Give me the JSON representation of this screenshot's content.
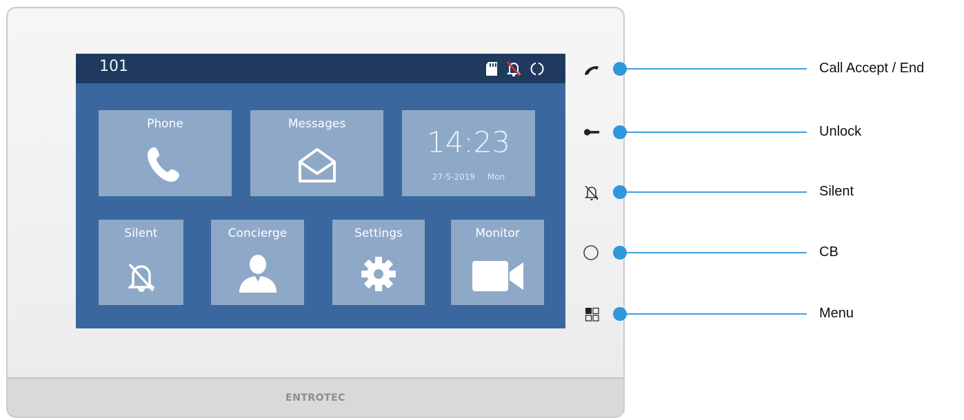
{
  "screen": {
    "room_number": "101",
    "status_icons": [
      "sd-card-icon",
      "bell-muted-icon",
      "circle-icon"
    ],
    "tiles": [
      {
        "label": "Phone",
        "icon": "phone-icon"
      },
      {
        "label": "Messages",
        "icon": "envelope-open-icon"
      },
      {
        "label": "Silent",
        "icon": "bell-muted-icon"
      },
      {
        "label": "Concierge",
        "icon": "person-icon"
      },
      {
        "label": "Settings",
        "icon": "gear-icon"
      },
      {
        "label": "Monitor",
        "icon": "video-camera-icon"
      }
    ],
    "clock": {
      "time": "14:23",
      "date": "27-5-2019",
      "day": "Mon"
    }
  },
  "device": {
    "brand": "ENTROTEC"
  },
  "buttons": [
    {
      "icon": "handset-icon",
      "label": "Call Accept / End"
    },
    {
      "icon": "key-icon",
      "label": "Unlock"
    },
    {
      "icon": "bell-muted-icon",
      "label": "Silent"
    },
    {
      "icon": "circle-icon",
      "label": "CB"
    },
    {
      "icon": "grid-menu-icon",
      "label": "Menu"
    }
  ],
  "colors": {
    "screen_bg": "#3a679e",
    "status_bar": "#1f3a5e",
    "tile": "#8ea8c8",
    "callout": "#2e97dd"
  }
}
